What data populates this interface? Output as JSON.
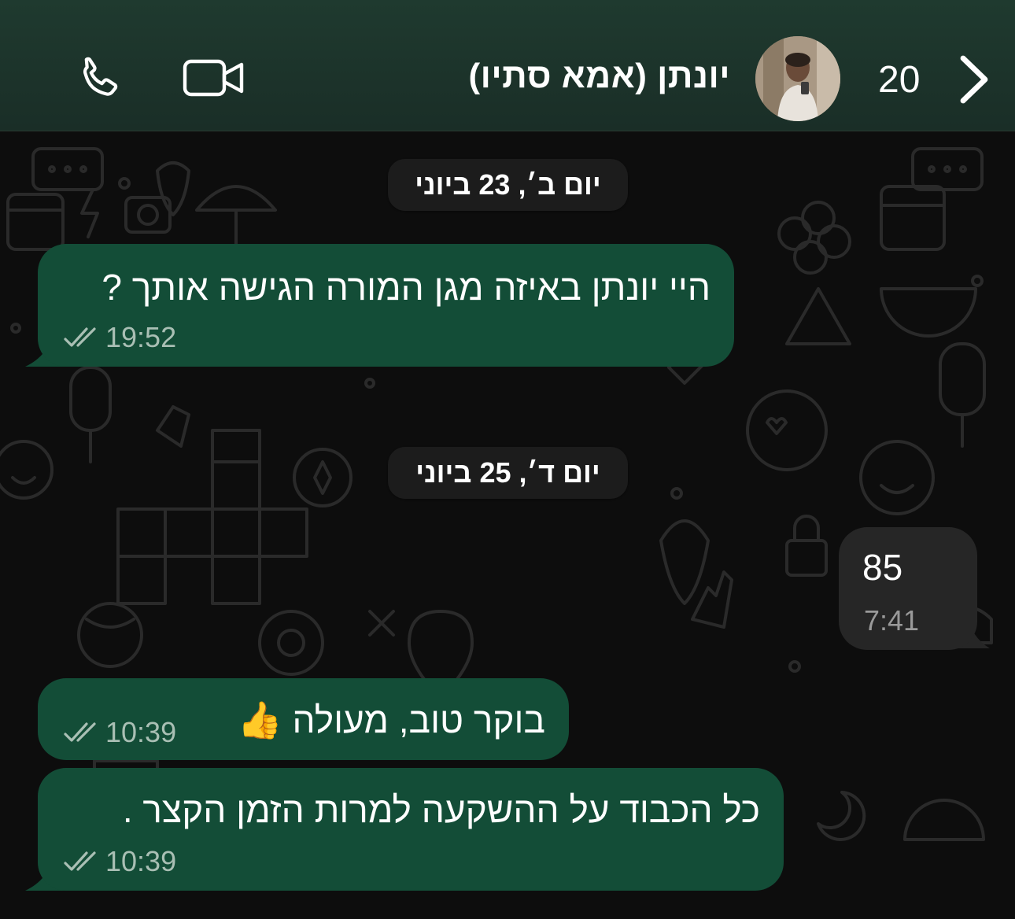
{
  "header": {
    "back_label": "20",
    "contact_name": "יונתן (אמא סתיו)",
    "icons": [
      "phone-icon",
      "video-icon",
      "chevron-left-icon"
    ],
    "bg_color": "#1f3a2f"
  },
  "dates": [
    "יום ב׳, 23 ביוני",
    "יום ד׳, 25 ביוני"
  ],
  "messages": [
    {
      "direction": "outgoing",
      "text": "היי יונתן באיזה מגן המורה הגישה אותך ?",
      "time": "19:52",
      "read": true
    },
    {
      "direction": "incoming",
      "text": "85",
      "time": "7:41"
    },
    {
      "direction": "outgoing",
      "text": "בוקר טוב, מעולה 👍",
      "time": "10:39",
      "read": true
    },
    {
      "direction": "outgoing",
      "text": "כל הכבוד על ההשקעה למרות הזמן הקצר .",
      "time": "10:39",
      "read": true
    }
  ],
  "colors": {
    "outgoing_bubble": "#134d37",
    "incoming_bubble": "#262626",
    "date_pill": "#1c1c1c",
    "wallpaper": "#0d0d0d"
  }
}
